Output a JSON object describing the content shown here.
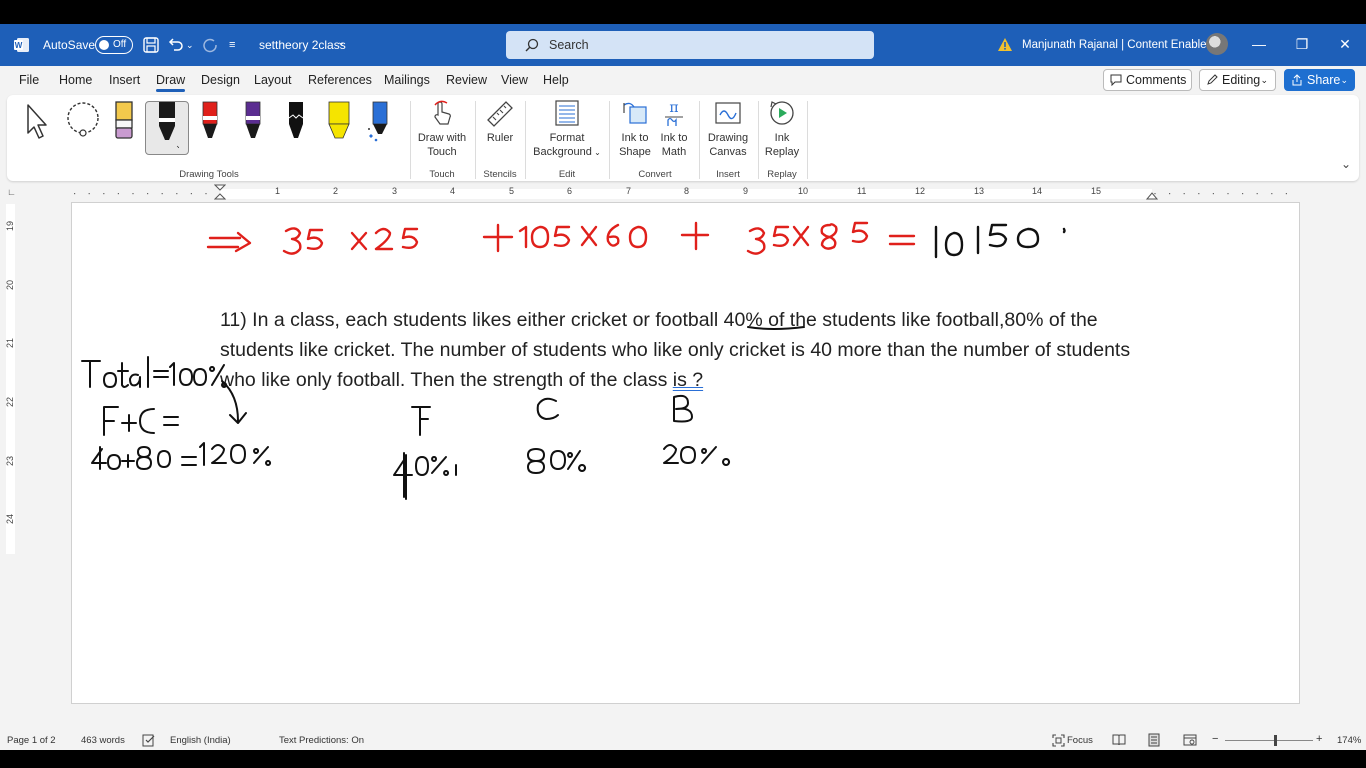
{
  "titlebar": {
    "autosave_label": "AutoSave",
    "autosave_state": "Off",
    "document_name": "settheory 2class",
    "search_placeholder": "Search",
    "user_name": "Manjunath Rajanal | Content Enablers"
  },
  "tabs": [
    {
      "label": "File"
    },
    {
      "label": "Home"
    },
    {
      "label": "Insert"
    },
    {
      "label": "Draw"
    },
    {
      "label": "Design"
    },
    {
      "label": "Layout"
    },
    {
      "label": "References"
    },
    {
      "label": "Mailings"
    },
    {
      "label": "Review"
    },
    {
      "label": "View"
    },
    {
      "label": "Help"
    }
  ],
  "top_buttons": {
    "comments": "Comments",
    "editing": "Editing",
    "share": "Share"
  },
  "ribbon": {
    "groups": {
      "drawing_tools": "Drawing Tools",
      "touch": "Touch",
      "stencils": "Stencils",
      "edit": "Edit",
      "convert": "Convert",
      "insert": "Insert",
      "replay": "Replay"
    },
    "buttons": {
      "draw_with_touch": [
        "Draw with",
        "Touch"
      ],
      "ruler": [
        "Ruler"
      ],
      "format_background": [
        "Format",
        "Background"
      ],
      "ink_to_shape": [
        "Ink to",
        "Shape"
      ],
      "ink_to_math": [
        "Ink to",
        "Math"
      ],
      "drawing_canvas": [
        "Drawing",
        "Canvas"
      ],
      "ink_replay": [
        "Ink",
        "Replay"
      ]
    },
    "pen_colors": [
      "#1a1a1a",
      "#e0201b",
      "#5b2d91",
      "#111111",
      "#f5e400",
      "#2a6fd6"
    ]
  },
  "ruler": {
    "numbers": [
      "1",
      "2",
      "3",
      "4",
      "5",
      "6",
      "7",
      "8",
      "9",
      "10",
      "11",
      "12",
      "13",
      "14",
      "15"
    ]
  },
  "vruler": {
    "numbers": [
      "19",
      "20",
      "21",
      "22",
      "23",
      "24"
    ]
  },
  "document": {
    "question_parts": [
      "11) In a class, each students likes either cricket or football ",
      "40% ",
      "of the students like football,80% of the students like cricket. The number of students who like only cricket is 40 more than the number of students who like only football. Then the strength of the class ",
      "is ?"
    ],
    "ink_red_line": "=> 35 x 25 + 105 x 60 + 35 x 85 = 10150",
    "ink_notes": [
      "Total=100%",
      "F+C =",
      "40+80 = 120%",
      "F",
      "C",
      "B",
      "40%",
      "80%",
      "20%"
    ]
  },
  "statusbar": {
    "page": "Page 1 of 2",
    "words": "463 words",
    "language": "English (India)",
    "text_predictions": "Text Predictions: On",
    "focus": "Focus",
    "zoom": "174%"
  }
}
